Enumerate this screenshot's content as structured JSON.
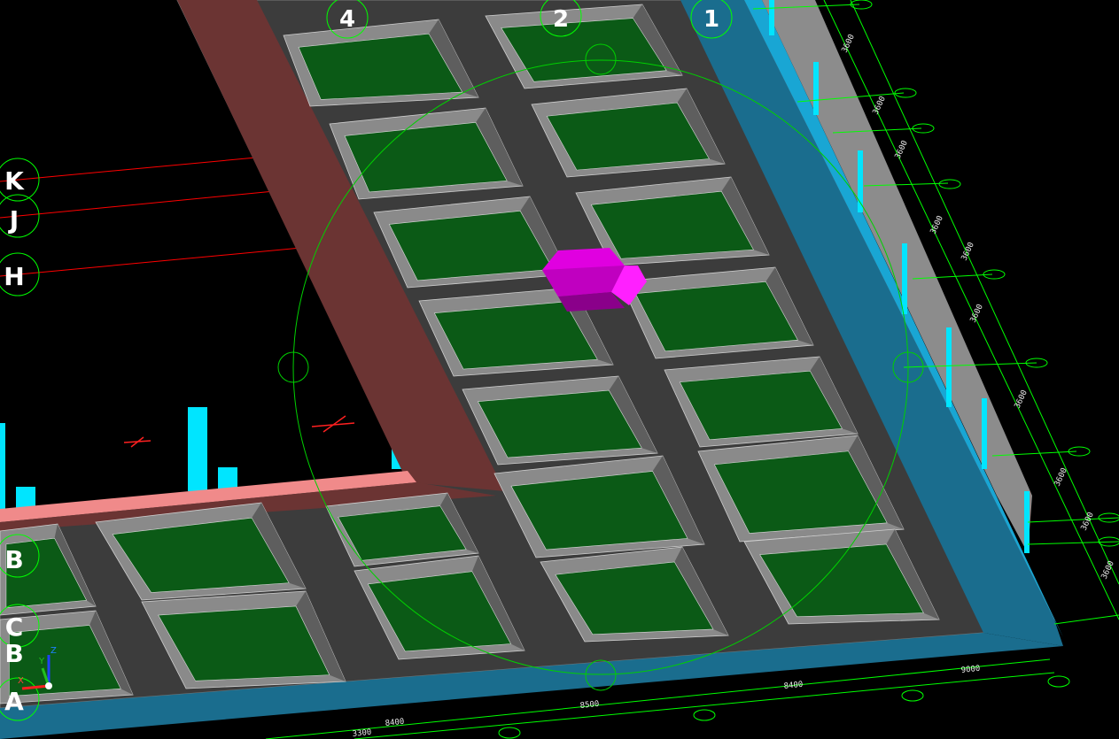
{
  "viewport": {
    "background": "#000000",
    "colors": {
      "slab": "#3c3c3c",
      "pocket_floor": "#0b5a16",
      "pocket_wall": "#8a8a8a",
      "beam": "#6b3433",
      "beam_top": "#f08a8a",
      "edge": "#1a6d8e",
      "column": "#00e5ff",
      "grid_line": "#00ff00",
      "axis_red": "#ff0000",
      "selection": "#e000e0"
    }
  },
  "column_grid": [
    {
      "label": "4"
    },
    {
      "label": "2"
    },
    {
      "label": "1"
    }
  ],
  "row_grid": [
    {
      "label": "K"
    },
    {
      "label": "J"
    },
    {
      "label": "H"
    },
    {
      "label": "B"
    },
    {
      "label": "C"
    },
    {
      "label": "B"
    },
    {
      "label": "A"
    }
  ],
  "dimensions": [
    {
      "text": "9000"
    },
    {
      "text": "8400"
    },
    {
      "text": "8500"
    },
    {
      "text": "8400"
    },
    {
      "text": "3300"
    }
  ],
  "side_dimensions": [
    "3600",
    "3600",
    "3600",
    "3600",
    "3600",
    "3600",
    "3600",
    "3600",
    "3600",
    "3600"
  ],
  "ucs_icon": {
    "x": "X",
    "y": "Y",
    "z": "Z"
  },
  "selected_object": "selected-solid",
  "navigation_ring": "orbit-navigation-circle"
}
